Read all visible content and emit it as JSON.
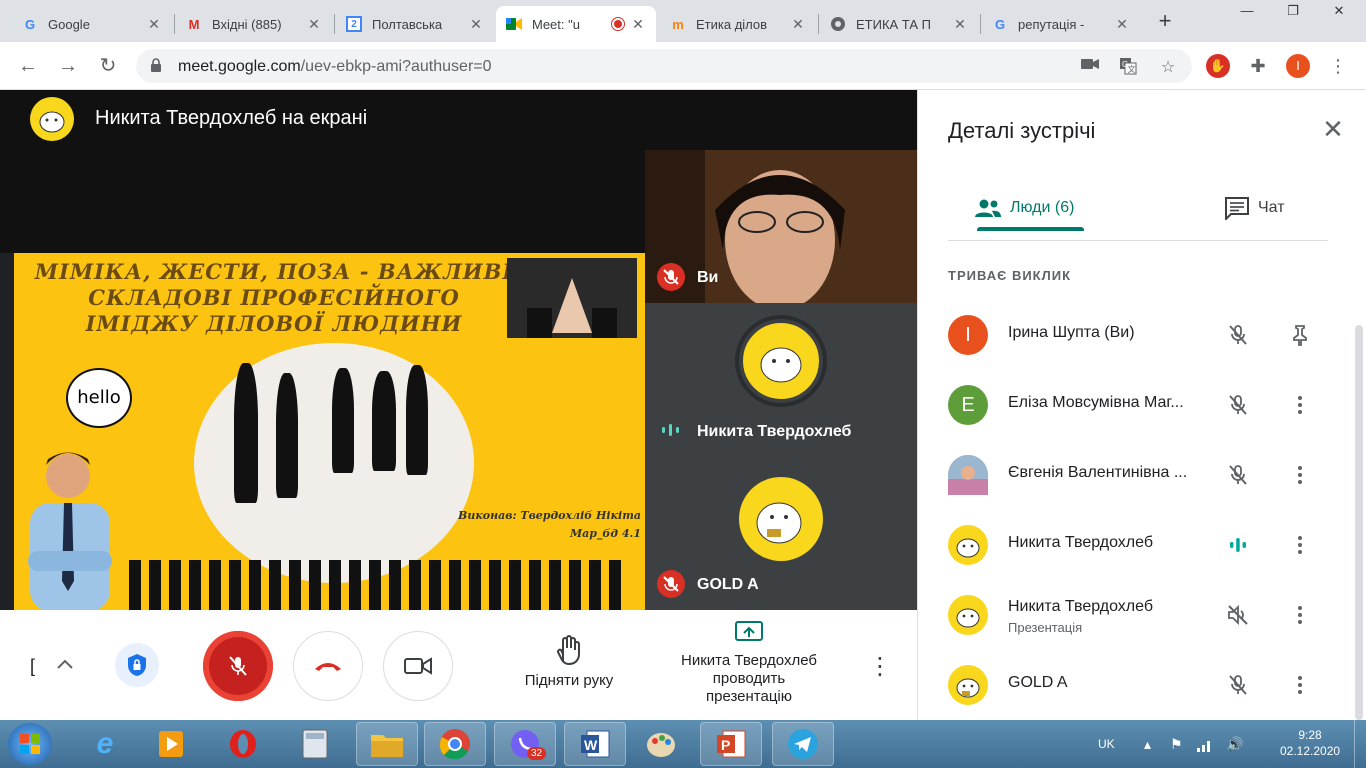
{
  "browser": {
    "tabs": [
      {
        "label": "Google",
        "favicon": "google-icon"
      },
      {
        "label": "Вхідні (885)",
        "favicon": "gmail-icon"
      },
      {
        "label": "Полтавська",
        "favicon": "calendar-icon",
        "badge": "2"
      },
      {
        "label": "Meet: \"u",
        "favicon": "meet-icon",
        "active": true
      },
      {
        "label": "Етика ділов",
        "favicon": "moodle-icon"
      },
      {
        "label": "ЕТИКА ТА П",
        "favicon": "globe-icon"
      },
      {
        "label": "репутація -",
        "favicon": "google-icon"
      }
    ],
    "url_host": "meet.google.com",
    "url_path": "/uev-ebkp-ami?authuser=0",
    "profile_initial": "I"
  },
  "stage": {
    "title": "Никита Твердохлеб на екрані",
    "slide": {
      "title_lines": [
        "МІМІКА, ЖЕСТИ, ПОЗА - ВАЖЛИВІ",
        "СКЛАДОВІ ПРОФЕСІЙНОГО",
        "ІМІДЖУ ДІЛОВОЇ ЛЮДИНИ"
      ],
      "bubble": "hello",
      "author_lines": [
        "Виконав: Твердохліб Нікіта",
        "Мар_бд 4.1"
      ]
    }
  },
  "tiles": [
    {
      "name": "Ви",
      "muted": true
    },
    {
      "name": "Никита Твердохлеб",
      "speaking": true
    },
    {
      "name": "GOLD A",
      "muted": true
    }
  ],
  "controls": {
    "raise_hand": "Підняти руку",
    "presenting_line1": "Никита Твердохлеб",
    "presenting_line2": "проводить",
    "presenting_line3": "презентацію"
  },
  "panel": {
    "title": "Деталі зустрічі",
    "tab_people": "Люди (6)",
    "tab_chat": "Чат",
    "section": "ТРИВАЄ ВИКЛИК",
    "people": [
      {
        "name": "Ірина Шупта (Ви)",
        "avatar_letter": "I",
        "avatar_color": "#e8501e",
        "status": "muted",
        "action": "pin"
      },
      {
        "name": "Еліза Мовсумівна Маг...",
        "avatar_letter": "E",
        "avatar_color": "#5e9e3a",
        "status": "muted",
        "action": "more"
      },
      {
        "name": "Євгенія Валентинівна ...",
        "avatar_letter": "",
        "avatar_color": "#8aa3c0",
        "status": "muted",
        "action": "more"
      },
      {
        "name": "Никита Твердохлеб",
        "avatar_letter": "",
        "avatar_color": "#f9d71c",
        "status": "speaking",
        "action": "more"
      },
      {
        "name": "Никита Твердохлеб",
        "sub": "Презентація",
        "avatar_letter": "",
        "avatar_color": "#f9d71c",
        "status": "audio-off",
        "action": "more"
      },
      {
        "name": "GOLD A",
        "avatar_letter": "",
        "avatar_color": "#f9d71c",
        "status": "muted",
        "action": "more"
      }
    ]
  },
  "taskbar": {
    "lang": "UK",
    "time": "9:28",
    "date": "02.12.2020",
    "viber_badge": "32"
  }
}
